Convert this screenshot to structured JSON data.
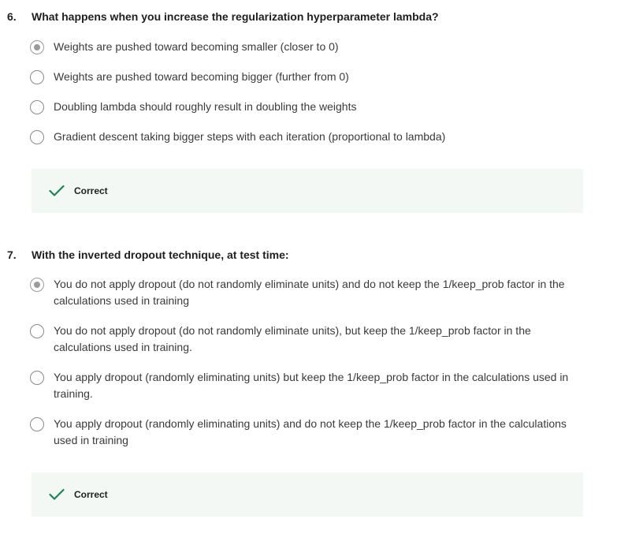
{
  "questions": [
    {
      "number": "6.",
      "text": "What happens when you increase the regularization hyperparameter lambda?",
      "options": [
        {
          "label": "Weights are pushed toward becoming smaller (closer to 0)",
          "selected": true
        },
        {
          "label": "Weights are pushed toward becoming bigger (further from 0)",
          "selected": false
        },
        {
          "label": "Doubling lambda should roughly result in doubling the weights",
          "selected": false
        },
        {
          "label": "Gradient descent taking bigger steps with each iteration (proportional to lambda)",
          "selected": false
        }
      ],
      "feedback": {
        "label": "Correct",
        "icon": "checkmark-icon",
        "color": "#1f8354"
      }
    },
    {
      "number": "7.",
      "text": "With the inverted dropout technique, at test time:",
      "options": [
        {
          "label": "You do not apply dropout (do not randomly eliminate units) and do not keep the 1/keep_prob factor in the calculations used in training",
          "selected": true
        },
        {
          "label": "You do not apply dropout (do not randomly eliminate units), but keep the 1/keep_prob factor in the calculations used in training.",
          "selected": false
        },
        {
          "label": "You apply dropout (randomly eliminating units) but keep the 1/keep_prob factor in the calculations used in training.",
          "selected": false
        },
        {
          "label": "You apply dropout (randomly eliminating units) and do not keep the 1/keep_prob factor in the calculations used in training",
          "selected": false
        }
      ],
      "feedback": {
        "label": "Correct",
        "icon": "checkmark-icon",
        "color": "#1f8354"
      }
    }
  ]
}
